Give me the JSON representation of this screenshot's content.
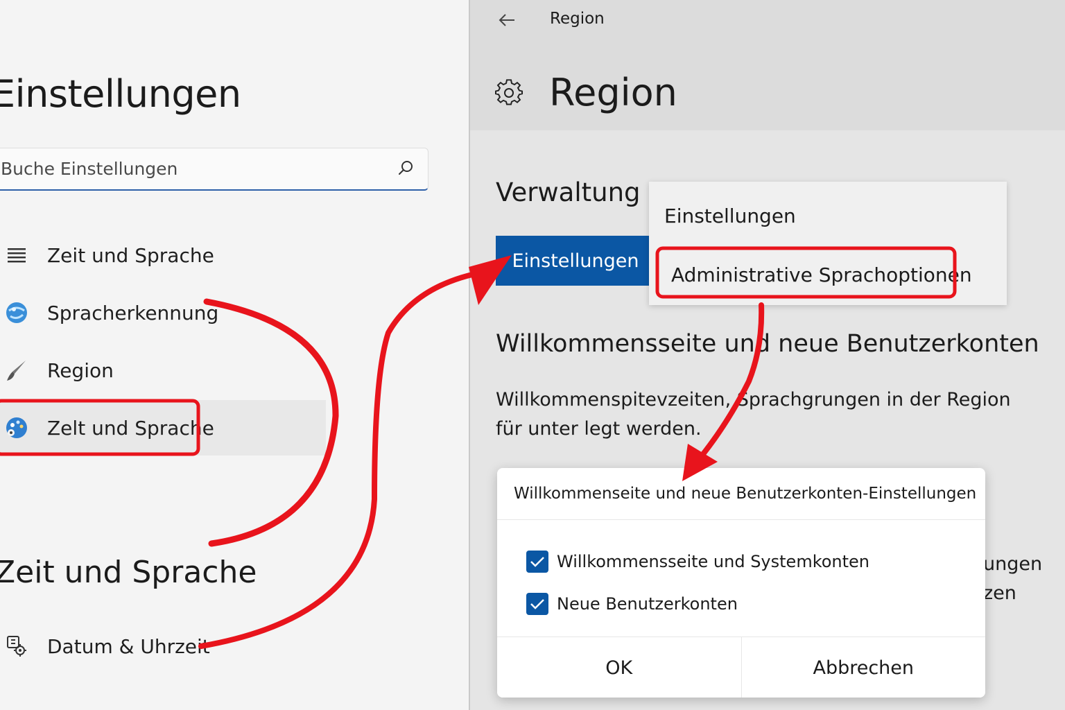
{
  "left": {
    "app_title": "Einstellungen",
    "search_placeholder": "Buche Einstellungen",
    "nav_items": [
      {
        "label": "Zeit und Sprache",
        "icon": "list-icon"
      },
      {
        "label": "Spracherkennung",
        "icon": "globe-icon"
      },
      {
        "label": "Region",
        "icon": "brush-icon"
      },
      {
        "label": "Zelt und Sprache",
        "icon": "palette-icon"
      }
    ],
    "section_heading": "Zeit und Sprache",
    "section_items": [
      {
        "label": "Datum & Uhrzeit",
        "icon": "clock-gear-icon"
      }
    ]
  },
  "right": {
    "breadcrumb": "Region",
    "page_title": "Region",
    "group_heading": "Verwaltung",
    "primary_button": "Einstellungen",
    "flyout": {
      "items": [
        "Einstellungen",
        "Administrative Sprachoptionen"
      ]
    },
    "sub_heading": "Willkommensseite und neue Benutzerkonten",
    "description": "Willkommenspitevzeiten, Sprachgrungen in der Region für unter legt werden.",
    "background_fragments": [
      "ungen",
      "zen"
    ],
    "dialog": {
      "title": "Willkommenseite und neue Benutzerkonten-Einstellungen",
      "checkboxes": [
        {
          "label": "Willkommensseite und Systemkonten",
          "checked": true
        },
        {
          "label": "Neue Benutzerkonten",
          "checked": true
        }
      ],
      "ok_label": "OK",
      "cancel_label": "Abbrechen"
    }
  },
  "colors": {
    "accent": "#0b57a4",
    "annotation": "#e8141c"
  }
}
